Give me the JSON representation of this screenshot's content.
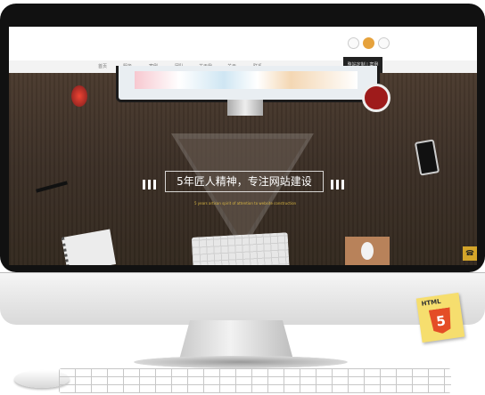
{
  "header": {
    "icons": [
      "phone-icon",
      "user-icon",
      "weixin-icon"
    ]
  },
  "nav": {
    "items": [
      "首页",
      "服务",
      "案例",
      "团队",
      "关于我",
      "关于",
      "联系"
    ],
    "cta": "整站定制 | 案例"
  },
  "hero": {
    "slogan": "5年匠人精神，专注网站建设",
    "subline": "5 years artisan spirit of attention to website construction"
  },
  "side_tab": {
    "icon": "phone-icon",
    "glyph": "☎"
  },
  "badge": {
    "label": "HTML",
    "number": "5"
  },
  "colors": {
    "accent": "#d4a52a",
    "hero_bg": "#3b2f26",
    "html5": "#e44d26"
  }
}
